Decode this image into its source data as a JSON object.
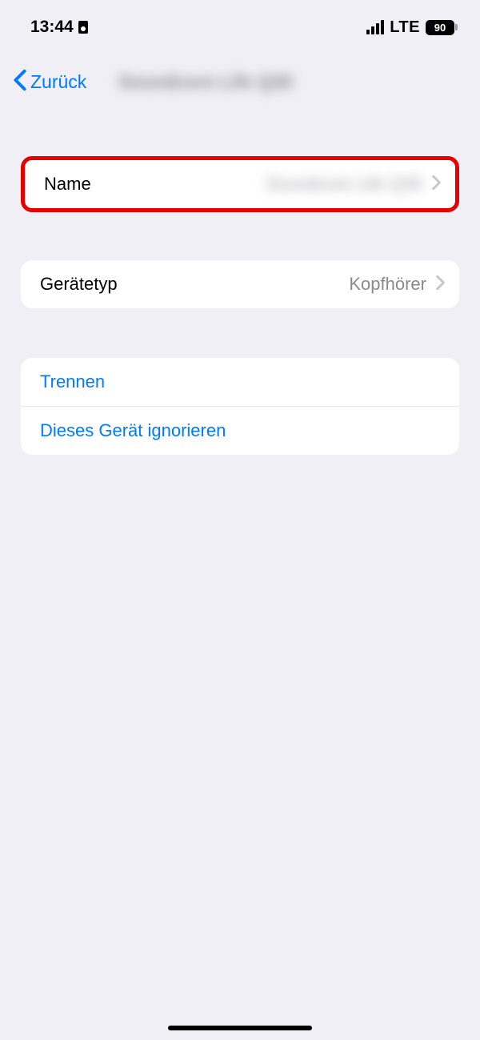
{
  "status": {
    "time": "13:44",
    "network": "LTE",
    "battery": "90"
  },
  "nav": {
    "back_label": "Zurück",
    "title": "Soundcore Life Q30"
  },
  "rows": {
    "name_label": "Name",
    "name_value": "Soundcore Life Q30",
    "device_type_label": "Gerätetyp",
    "device_type_value": "Kopfhörer"
  },
  "actions": {
    "disconnect": "Trennen",
    "forget": "Dieses Gerät ignorieren"
  }
}
